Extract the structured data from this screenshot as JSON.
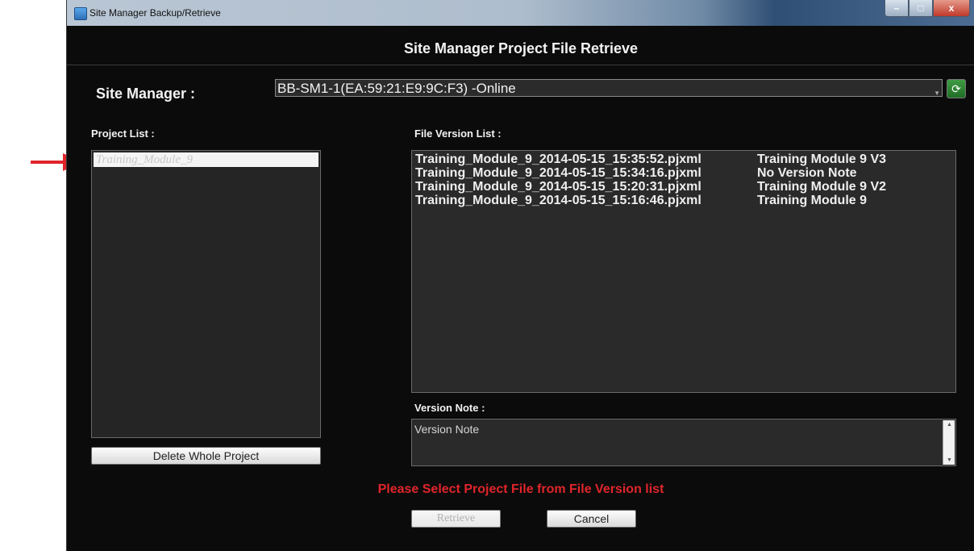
{
  "window": {
    "title": "Site Manager Backup/Retrieve",
    "minimize_glyph": "–",
    "maximize_glyph": "□",
    "close_glyph": "x"
  },
  "header": {
    "title": "Site Manager Project File Retrieve"
  },
  "site_manager": {
    "label": "Site Manager :",
    "selected": "BB-SM1-1(EA:59:21:E9:9C:F3) -Online",
    "refresh_icon": "refresh-icon"
  },
  "project_list": {
    "label": "Project List :",
    "items": [
      "Training_Module_9"
    ]
  },
  "file_version_list": {
    "label": "File Version List :",
    "rows": [
      {
        "file": "Training_Module_9_2014-05-15_15:35:52.pjxml",
        "note": "Training Module 9 V3"
      },
      {
        "file": "Training_Module_9_2014-05-15_15:34:16.pjxml",
        "note": "No Version Note"
      },
      {
        "file": "Training_Module_9_2014-05-15_15:20:31.pjxml",
        "note": "Training Module 9 V2"
      },
      {
        "file": "Training_Module_9_2014-05-15_15:16:46.pjxml",
        "note": "Training Module 9"
      }
    ]
  },
  "version_note": {
    "label": "Version Note :",
    "placeholder": "Version Note"
  },
  "buttons": {
    "delete_whole_project": "Delete Whole Project",
    "retrieve": "Retrieve",
    "cancel": "Cancel"
  },
  "status_message": "Please Select Project File from File Version list",
  "colors": {
    "warning": "#e0252b",
    "arrow": "#e0252b",
    "window_bg": "#0b0b0b"
  }
}
